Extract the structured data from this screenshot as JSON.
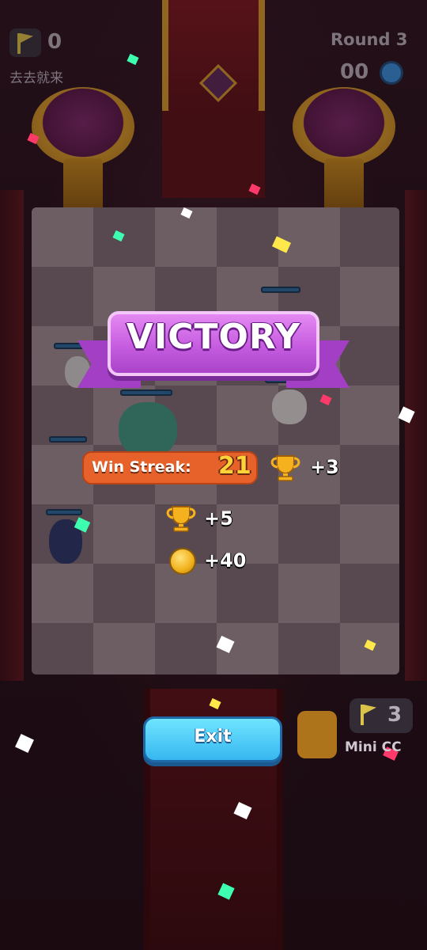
{
  "hud": {
    "player_trophies": "0",
    "player_name": "去去就来",
    "round_label": "Round 3",
    "timer": "00"
  },
  "victory": {
    "title": "VICTORY"
  },
  "rewards": {
    "streak_label": "Win Streak:",
    "streak_value": "21",
    "streak_trophies": "+3",
    "trophies": "+5",
    "coins": "+40"
  },
  "exit_button": {
    "label": "Exit"
  },
  "opponent": {
    "trophies": "3",
    "name": "Mini CC"
  },
  "colors": {
    "victory_banner": "#c65de0",
    "streak_pill": "#e7622b",
    "exit_button": "#37b7f0",
    "coin": "#f0b01a"
  },
  "icons": [
    "flag-icon",
    "timer-icon",
    "trophy-icon",
    "coin-icon"
  ]
}
